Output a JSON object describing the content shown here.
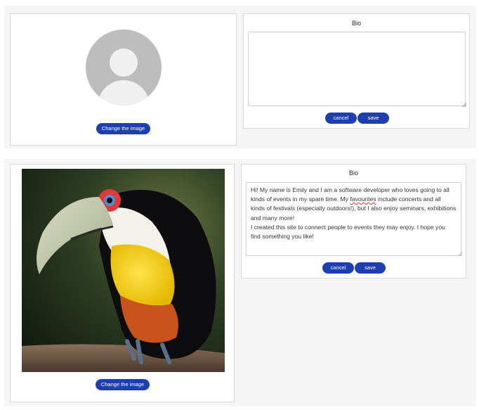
{
  "top_section": {
    "change_image_label": "Change the image",
    "bio": {
      "title": "Bio",
      "value": "",
      "cancel_label": "cancel",
      "save_label": "save"
    }
  },
  "bottom_section": {
    "change_image_label": "Change the image",
    "bio": {
      "title": "Bio",
      "text_before": "Hi! My name is Emily and I am a software developer who loves going to all kinds of events in my spare time. My ",
      "misspelled_word": "favourites",
      "text_after": " include concerts and all kinds of festivals (especially outdoors!), but I also enjoy seminars, exhibitions and many more!\nI created this site to connect people to events they may enjoy. I hope you find something you like!",
      "cancel_label": "cancel",
      "save_label": "save"
    },
    "photo_subject": "toucan"
  },
  "colors": {
    "accent": "#1e40af",
    "panel_bg": "#f5f5f5",
    "avatar_gray": "#bdbdbd"
  },
  "icons": [
    "default-avatar-icon",
    "textarea-resize-icon"
  ]
}
